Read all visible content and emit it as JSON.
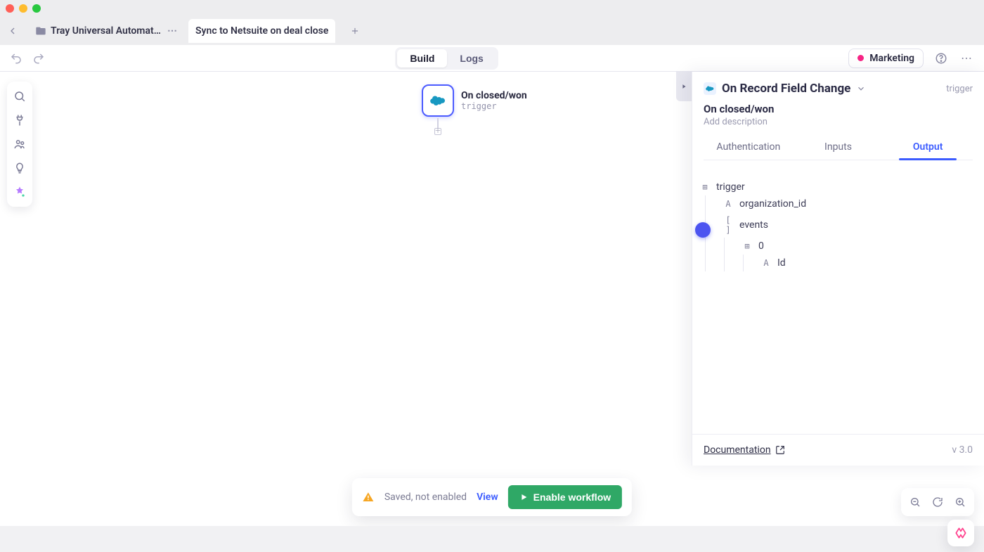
{
  "tabs": {
    "back_href": "#",
    "project": "Tray Universal Automatic…",
    "active": "Sync to Netsuite on deal close"
  },
  "toolbar": {
    "build": "Build",
    "logs": "Logs",
    "workspace": "Marketing"
  },
  "canvas": {
    "trigger": {
      "title": "On closed/won",
      "subtitle": "trigger"
    }
  },
  "panel": {
    "action_name": "On Record Field Change",
    "type_tag": "trigger",
    "step_title": "On closed/won",
    "description_placeholder": "Add description",
    "tabs": {
      "auth": "Authentication",
      "inputs": "Inputs",
      "output": "Output"
    },
    "tree": {
      "root": "trigger",
      "org": "organization_id",
      "events": "events",
      "idx0": "0",
      "id": "Id"
    },
    "doc": "Documentation",
    "version": "v 3.0"
  },
  "status": {
    "message": "Saved, not enabled",
    "view": "View",
    "enable": "Enable workflow"
  }
}
